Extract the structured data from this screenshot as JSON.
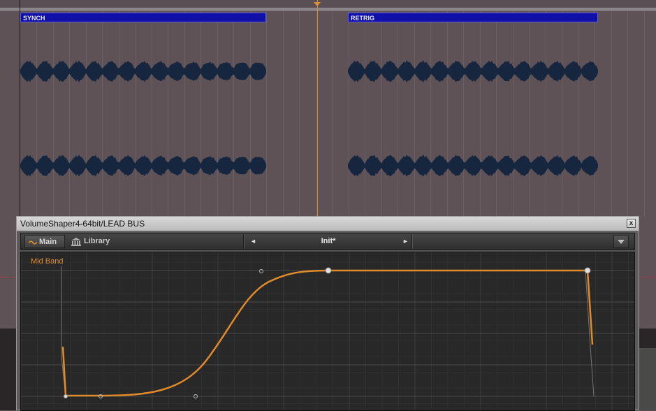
{
  "daw": {
    "clips": [
      {
        "label": "SYNCH"
      },
      {
        "label": "RETRIG"
      }
    ]
  },
  "plugin": {
    "window_title": "VolumeShaper4-64bit/LEAD BUS",
    "close_glyph": "x",
    "tabs": [
      {
        "label": "Main",
        "icon": "wave-icon",
        "active": true
      },
      {
        "label": "Library",
        "icon": "library-icon",
        "active": false
      }
    ],
    "preset": {
      "name": "Init*",
      "prev_glyph": "◄",
      "next_glyph": "►"
    },
    "band_label": "Mid Band",
    "colors": {
      "accent": "#e08a2a",
      "clip": "#1010a8",
      "waveform": "#15263e",
      "playhead": "#d88a2a"
    }
  }
}
